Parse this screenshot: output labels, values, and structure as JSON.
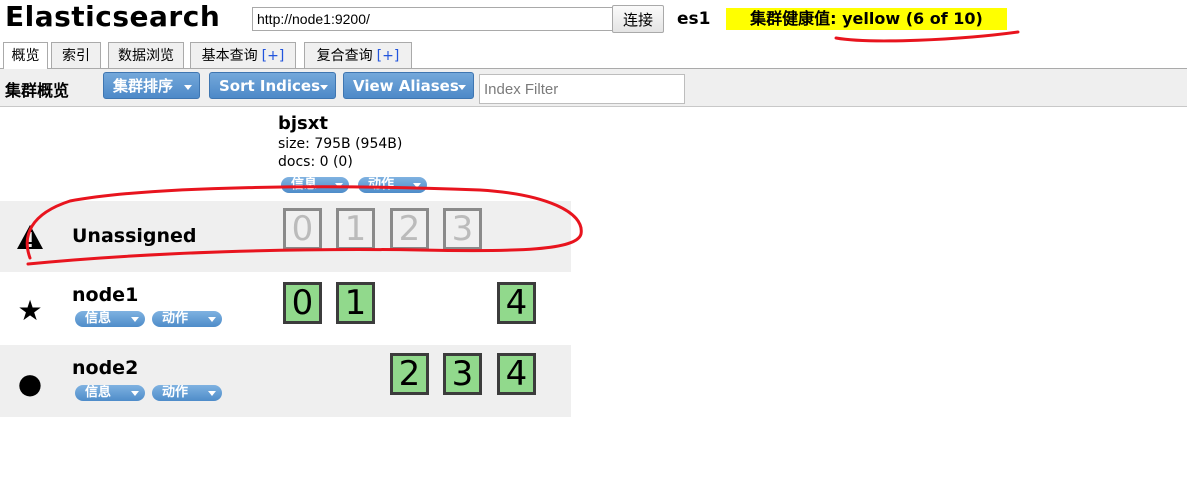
{
  "header": {
    "title": "Elasticsearch",
    "url_value": "http://node1:9200/",
    "connect_label": "连接",
    "cluster_name": "es1",
    "health_text": "集群健康值: yellow (6 of 10)",
    "health_color": "#ffff00"
  },
  "tabs": [
    {
      "label": "概览",
      "plus": "",
      "active": true
    },
    {
      "label": "索引",
      "plus": "",
      "active": false
    },
    {
      "label": "数据浏览",
      "plus": "",
      "active": false
    },
    {
      "label": "基本查询",
      "plus": "[+]",
      "active": false
    },
    {
      "label": "复合查询",
      "plus": "[+]",
      "active": false
    }
  ],
  "toolbar": {
    "title": "集群概览",
    "sort_cluster_label": "集群排序",
    "sort_indices_label": "Sort Indices",
    "view_aliases_label": "View Aliases",
    "index_filter_placeholder": "Index Filter",
    "button_color": "#4d89c8"
  },
  "index": {
    "name": "bjsxt",
    "size": "size: 795B (954B)",
    "docs": "docs: 0 (0)",
    "info_label": "信息",
    "action_label": "动作"
  },
  "rows": [
    {
      "name": "Unassigned",
      "icon": "warning-icon",
      "glyph": "⚠",
      "shards": [
        "0",
        "1",
        "2",
        "3"
      ]
    },
    {
      "name": "node1",
      "icon": "master-star-icon",
      "glyph": "★",
      "info_label": "信息",
      "action_label": "动作",
      "shards": [
        "0",
        "1",
        "4"
      ]
    },
    {
      "name": "node2",
      "icon": "data-node-dot-icon",
      "glyph": "●",
      "info_label": "信息",
      "action_label": "动作",
      "shards": [
        "2",
        "3",
        "4"
      ]
    }
  ],
  "colors": {
    "assigned_shard": "#91d98c",
    "unassigned_shard": "#f0f0f0",
    "annotation": "#e8141e"
  }
}
